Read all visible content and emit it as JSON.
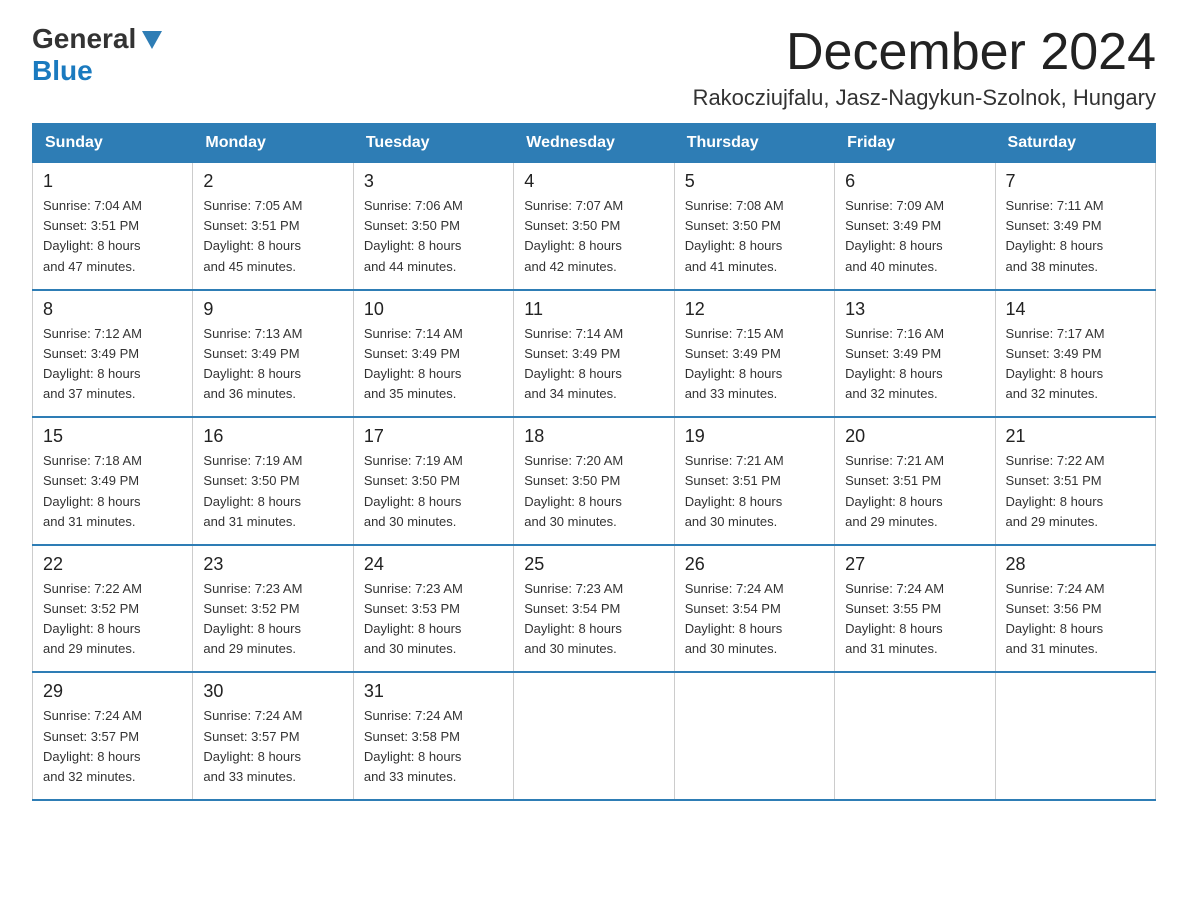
{
  "header": {
    "logo_general": "General",
    "logo_blue": "Blue",
    "main_title": "December 2024",
    "subtitle": "Rakocziujfalu, Jasz-Nagykun-Szolnok, Hungary"
  },
  "weekdays": [
    "Sunday",
    "Monday",
    "Tuesday",
    "Wednesday",
    "Thursday",
    "Friday",
    "Saturday"
  ],
  "weeks": [
    [
      {
        "day": "1",
        "sunrise": "7:04 AM",
        "sunset": "3:51 PM",
        "daylight": "8 hours and 47 minutes."
      },
      {
        "day": "2",
        "sunrise": "7:05 AM",
        "sunset": "3:51 PM",
        "daylight": "8 hours and 45 minutes."
      },
      {
        "day": "3",
        "sunrise": "7:06 AM",
        "sunset": "3:50 PM",
        "daylight": "8 hours and 44 minutes."
      },
      {
        "day": "4",
        "sunrise": "7:07 AM",
        "sunset": "3:50 PM",
        "daylight": "8 hours and 42 minutes."
      },
      {
        "day": "5",
        "sunrise": "7:08 AM",
        "sunset": "3:50 PM",
        "daylight": "8 hours and 41 minutes."
      },
      {
        "day": "6",
        "sunrise": "7:09 AM",
        "sunset": "3:49 PM",
        "daylight": "8 hours and 40 minutes."
      },
      {
        "day": "7",
        "sunrise": "7:11 AM",
        "sunset": "3:49 PM",
        "daylight": "8 hours and 38 minutes."
      }
    ],
    [
      {
        "day": "8",
        "sunrise": "7:12 AM",
        "sunset": "3:49 PM",
        "daylight": "8 hours and 37 minutes."
      },
      {
        "day": "9",
        "sunrise": "7:13 AM",
        "sunset": "3:49 PM",
        "daylight": "8 hours and 36 minutes."
      },
      {
        "day": "10",
        "sunrise": "7:14 AM",
        "sunset": "3:49 PM",
        "daylight": "8 hours and 35 minutes."
      },
      {
        "day": "11",
        "sunrise": "7:14 AM",
        "sunset": "3:49 PM",
        "daylight": "8 hours and 34 minutes."
      },
      {
        "day": "12",
        "sunrise": "7:15 AM",
        "sunset": "3:49 PM",
        "daylight": "8 hours and 33 minutes."
      },
      {
        "day": "13",
        "sunrise": "7:16 AM",
        "sunset": "3:49 PM",
        "daylight": "8 hours and 32 minutes."
      },
      {
        "day": "14",
        "sunrise": "7:17 AM",
        "sunset": "3:49 PM",
        "daylight": "8 hours and 32 minutes."
      }
    ],
    [
      {
        "day": "15",
        "sunrise": "7:18 AM",
        "sunset": "3:49 PM",
        "daylight": "8 hours and 31 minutes."
      },
      {
        "day": "16",
        "sunrise": "7:19 AM",
        "sunset": "3:50 PM",
        "daylight": "8 hours and 31 minutes."
      },
      {
        "day": "17",
        "sunrise": "7:19 AM",
        "sunset": "3:50 PM",
        "daylight": "8 hours and 30 minutes."
      },
      {
        "day": "18",
        "sunrise": "7:20 AM",
        "sunset": "3:50 PM",
        "daylight": "8 hours and 30 minutes."
      },
      {
        "day": "19",
        "sunrise": "7:21 AM",
        "sunset": "3:51 PM",
        "daylight": "8 hours and 30 minutes."
      },
      {
        "day": "20",
        "sunrise": "7:21 AM",
        "sunset": "3:51 PM",
        "daylight": "8 hours and 29 minutes."
      },
      {
        "day": "21",
        "sunrise": "7:22 AM",
        "sunset": "3:51 PM",
        "daylight": "8 hours and 29 minutes."
      }
    ],
    [
      {
        "day": "22",
        "sunrise": "7:22 AM",
        "sunset": "3:52 PM",
        "daylight": "8 hours and 29 minutes."
      },
      {
        "day": "23",
        "sunrise": "7:23 AM",
        "sunset": "3:52 PM",
        "daylight": "8 hours and 29 minutes."
      },
      {
        "day": "24",
        "sunrise": "7:23 AM",
        "sunset": "3:53 PM",
        "daylight": "8 hours and 30 minutes."
      },
      {
        "day": "25",
        "sunrise": "7:23 AM",
        "sunset": "3:54 PM",
        "daylight": "8 hours and 30 minutes."
      },
      {
        "day": "26",
        "sunrise": "7:24 AM",
        "sunset": "3:54 PM",
        "daylight": "8 hours and 30 minutes."
      },
      {
        "day": "27",
        "sunrise": "7:24 AM",
        "sunset": "3:55 PM",
        "daylight": "8 hours and 31 minutes."
      },
      {
        "day": "28",
        "sunrise": "7:24 AM",
        "sunset": "3:56 PM",
        "daylight": "8 hours and 31 minutes."
      }
    ],
    [
      {
        "day": "29",
        "sunrise": "7:24 AM",
        "sunset": "3:57 PM",
        "daylight": "8 hours and 32 minutes."
      },
      {
        "day": "30",
        "sunrise": "7:24 AM",
        "sunset": "3:57 PM",
        "daylight": "8 hours and 33 minutes."
      },
      {
        "day": "31",
        "sunrise": "7:24 AM",
        "sunset": "3:58 PM",
        "daylight": "8 hours and 33 minutes."
      },
      null,
      null,
      null,
      null
    ]
  ]
}
